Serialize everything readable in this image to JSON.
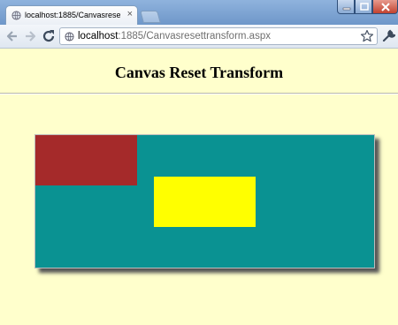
{
  "browser": {
    "tab_title": "localhost:1885/Canvasresettз",
    "tab_close": "×",
    "url_host": "localhost",
    "url_path": ":1885/Canvasresettransform.aspx"
  },
  "page": {
    "heading": "Canvas Reset Transform"
  },
  "canvas": {
    "background": "#0a9292",
    "rects": [
      {
        "name": "red",
        "color": "#a52a2a"
      },
      {
        "name": "yellow",
        "color": "#ffff00"
      }
    ]
  },
  "colors": {
    "page_bg": "#ffffcc",
    "accent": "#6e97c9"
  }
}
